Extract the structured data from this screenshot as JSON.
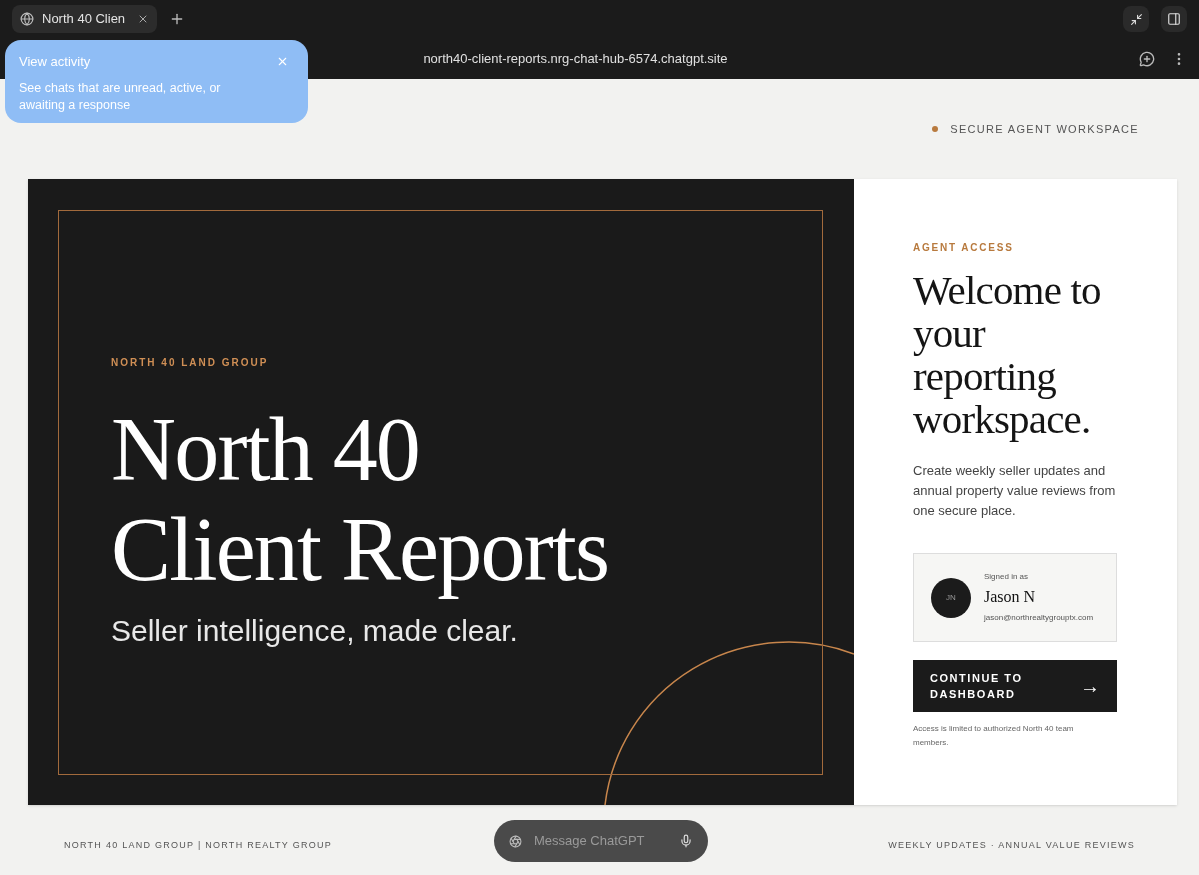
{
  "browser": {
    "tabs": [
      {
        "title": "North 40 Clien",
        "selected": true
      }
    ],
    "url": "north40-client-reports.nrg-chat-hub-6574.chatgpt.site"
  },
  "popover": {
    "title": "View activity",
    "body": "See chats that are unread, active, or awaiting a response"
  },
  "status": {
    "label": "SECURE AGENT WORKSPACE"
  },
  "hero": {
    "eyebrow": "NORTH 40 LAND GROUP",
    "title": "North 40 Client Reports",
    "tagline": "Seller intelligence, made clear."
  },
  "access": {
    "eyebrow": "AGENT ACCESS",
    "heading": "Welcome to your reporting workspace.",
    "description": "Create weekly seller updates and annual property value reviews from one secure place.",
    "user": {
      "caption": "Signed in as",
      "initials": "JN",
      "name": "Jason N",
      "email": "jason@northrealtygrouptx.com"
    },
    "button": "CONTINUE TO DASHBOARD",
    "arrow": "→",
    "note": "Access is limited to authorized North 40 team members."
  },
  "composer": {
    "placeholder": "Message ChatGPT"
  },
  "footer": {
    "left": "NORTH 40 LAND GROUP | NORTH REALTY GROUP",
    "right": "WEEKLY UPDATES · ANNUAL VALUE REVIEWS"
  }
}
